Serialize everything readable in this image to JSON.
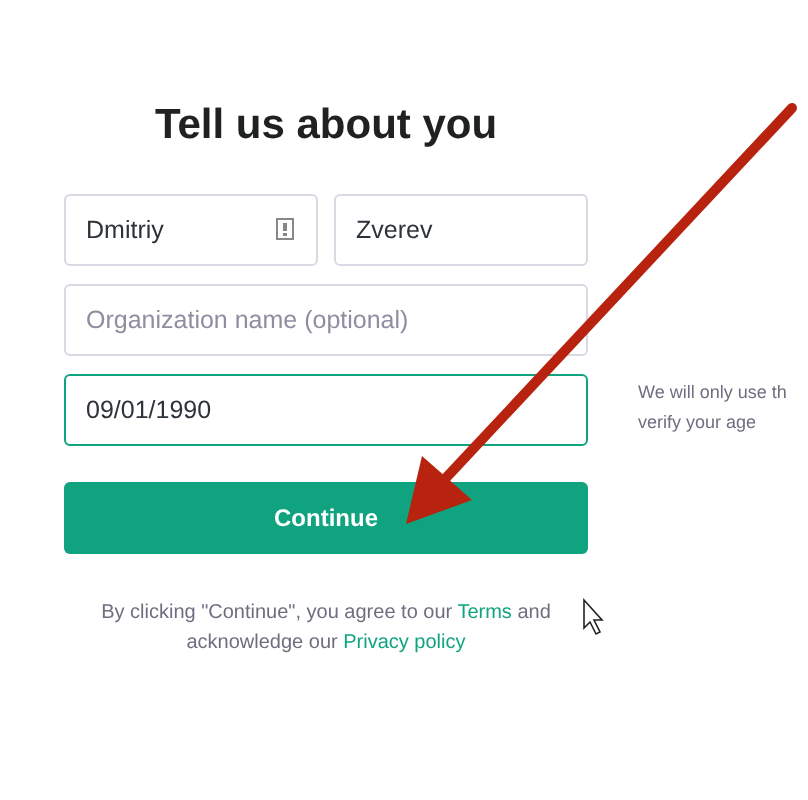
{
  "title": "Tell us about you",
  "fields": [
    {
      "value": "Dmitriy",
      "focused": false,
      "autofill_icon": true
    },
    {
      "value": "Zverev",
      "focused": false,
      "autofill_icon": false
    },
    {
      "placeholder": "Organization name (optional)",
      "focused": false,
      "autofill_icon": false
    },
    {
      "value": "09/01/1990",
      "focused": true,
      "autofill_icon": false
    }
  ],
  "side_note": [
    "We will only use th",
    "verify your age"
  ],
  "continue_button": "Continue",
  "footer": {
    "before": "By clicking \"Continue\", you agree to our ",
    "terms_link": "Terms",
    "middle": " and acknowledge our ",
    "privacy_link": "Privacy policy"
  }
}
